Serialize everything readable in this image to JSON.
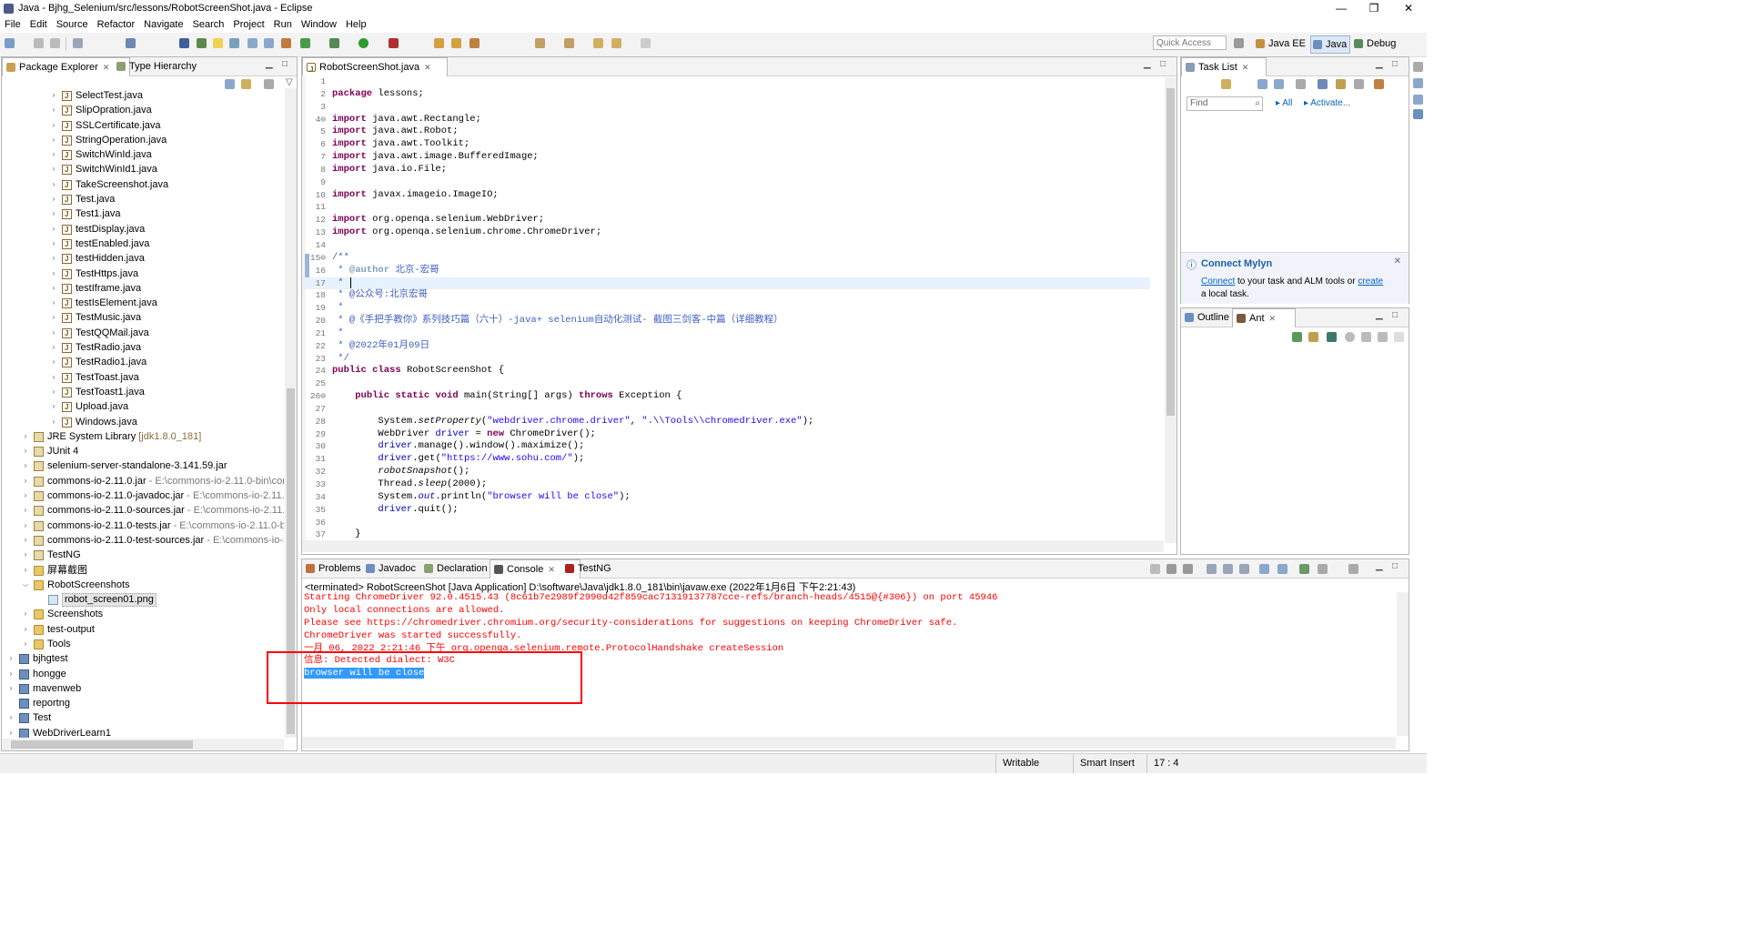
{
  "window": {
    "title": "Java - Bjhg_Selenium/src/lessons/RobotScreenShot.java - Eclipse"
  },
  "menu": [
    "File",
    "Edit",
    "Source",
    "Refactor",
    "Navigate",
    "Search",
    "Project",
    "Run",
    "Window",
    "Help"
  ],
  "toolbar": {
    "quick_access_placeholder": "Quick Access",
    "perspectives": [
      "Java EE",
      "Java",
      "Debug"
    ]
  },
  "package_explorer": {
    "tabs": [
      "Package Explorer",
      "Type Hierarchy"
    ],
    "items": [
      {
        "label": "SelectTest.java",
        "kind": "java",
        "level": 3,
        "twisty": ">"
      },
      {
        "label": "SlipOpration.java",
        "kind": "java",
        "level": 3,
        "twisty": ">"
      },
      {
        "label": "SSLCertificate.java",
        "kind": "java",
        "level": 3,
        "twisty": ">"
      },
      {
        "label": "StringOperation.java",
        "kind": "java",
        "level": 3,
        "twisty": ">"
      },
      {
        "label": "SwitchWinId.java",
        "kind": "java",
        "level": 3,
        "twisty": ">"
      },
      {
        "label": "SwitchWinId1.java",
        "kind": "java",
        "level": 3,
        "twisty": ">"
      },
      {
        "label": "TakeScreenshot.java",
        "kind": "java",
        "level": 3,
        "twisty": ">"
      },
      {
        "label": "Test.java",
        "kind": "java",
        "level": 3,
        "twisty": ">"
      },
      {
        "label": "Test1.java",
        "kind": "java",
        "level": 3,
        "twisty": ">"
      },
      {
        "label": "testDisplay.java",
        "kind": "java",
        "level": 3,
        "twisty": ">"
      },
      {
        "label": "testEnabled.java",
        "kind": "java",
        "level": 3,
        "twisty": ">"
      },
      {
        "label": "testHidden.java",
        "kind": "java",
        "level": 3,
        "twisty": ">"
      },
      {
        "label": "TestHttps.java",
        "kind": "java",
        "level": 3,
        "twisty": ">"
      },
      {
        "label": "testIframe.java",
        "kind": "java",
        "level": 3,
        "twisty": ">"
      },
      {
        "label": "testIsElement.java",
        "kind": "java",
        "level": 3,
        "twisty": ">"
      },
      {
        "label": "TestMusic.java",
        "kind": "java",
        "level": 3,
        "twisty": ">"
      },
      {
        "label": "TestQQMail.java",
        "kind": "java",
        "level": 3,
        "twisty": ">"
      },
      {
        "label": "TestRadio.java",
        "kind": "java",
        "level": 3,
        "twisty": ">"
      },
      {
        "label": "TestRadio1.java",
        "kind": "java",
        "level": 3,
        "twisty": ">"
      },
      {
        "label": "TestToast.java",
        "kind": "java",
        "level": 3,
        "twisty": ">"
      },
      {
        "label": "TestToast1.java",
        "kind": "java",
        "level": 3,
        "twisty": ">"
      },
      {
        "label": "Upload.java",
        "kind": "java",
        "level": 3,
        "twisty": ">"
      },
      {
        "label": "Windows.java",
        "kind": "java",
        "level": 3,
        "twisty": ">"
      },
      {
        "label": "JRE System Library",
        "extra": "[jdk1.8.0_181]",
        "kind": "jar",
        "level": 1,
        "twisty": ">"
      },
      {
        "label": "JUnit 4",
        "kind": "jar",
        "level": 1,
        "twisty": ">"
      },
      {
        "label": "selenium-server-standalone-3.141.59.jar",
        "kind": "jar",
        "level": 1,
        "twisty": ">"
      },
      {
        "label": "commons-io-2.11.0.jar",
        "extra": " - E:\\commons-io-2.11.0-bin\\cor",
        "kind": "jar",
        "level": 1,
        "twisty": ">"
      },
      {
        "label": "commons-io-2.11.0-javadoc.jar",
        "extra": " - E:\\commons-io-2.11.0",
        "kind": "jar",
        "level": 1,
        "twisty": ">"
      },
      {
        "label": "commons-io-2.11.0-sources.jar",
        "extra": " - E:\\commons-io-2.11.0",
        "kind": "jar",
        "level": 1,
        "twisty": ">"
      },
      {
        "label": "commons-io-2.11.0-tests.jar",
        "extra": " - E:\\commons-io-2.11.0-bi",
        "kind": "jar",
        "level": 1,
        "twisty": ">"
      },
      {
        "label": "commons-io-2.11.0-test-sources.jar",
        "extra": " - E:\\commons-io-2",
        "kind": "jar",
        "level": 1,
        "twisty": ">"
      },
      {
        "label": "TestNG",
        "kind": "jar",
        "level": 1,
        "twisty": ">"
      },
      {
        "label": "屏幕截图",
        "kind": "folder",
        "level": 1,
        "twisty": ">"
      },
      {
        "label": "RobotScreenshots",
        "kind": "folder",
        "level": 1,
        "twisty": "v"
      },
      {
        "label": "robot_screen01.png",
        "kind": "png",
        "level": 2,
        "twisty": "",
        "selected": true
      },
      {
        "label": "Screenshots",
        "kind": "folder",
        "level": 1,
        "twisty": ">"
      },
      {
        "label": "test-output",
        "kind": "folder",
        "level": 1,
        "twisty": ">"
      },
      {
        "label": "Tools",
        "kind": "folder",
        "level": 1,
        "twisty": ">"
      },
      {
        "label": "bjhgtest",
        "kind": "project",
        "level": 0,
        "twisty": ">"
      },
      {
        "label": "hongge",
        "kind": "project",
        "level": 0,
        "twisty": ">"
      },
      {
        "label": "mavenweb",
        "kind": "project",
        "level": 0,
        "twisty": ">"
      },
      {
        "label": "reportng",
        "kind": "project",
        "level": 0,
        "twisty": ""
      },
      {
        "label": "Test",
        "kind": "project",
        "level": 0,
        "twisty": ">"
      },
      {
        "label": "WebDriverLearn1",
        "kind": "project",
        "level": 0,
        "twisty": ">"
      }
    ]
  },
  "editor": {
    "tab": "RobotScreenShot.java",
    "lines": [
      {
        "n": "1",
        "html": ""
      },
      {
        "n": "2",
        "html": "<span class='kw'>package</span> lessons;"
      },
      {
        "n": "3",
        "html": ""
      },
      {
        "n": "4⊖",
        "html": "<span class='kw'>import</span> java.awt.Rectangle;"
      },
      {
        "n": "5",
        "html": "<span class='kw'>import</span> java.awt.Robot;"
      },
      {
        "n": "6",
        "html": "<span class='kw'>import</span> java.awt.Toolkit;"
      },
      {
        "n": "7",
        "html": "<span class='kw'>import</span> java.awt.image.BufferedImage;"
      },
      {
        "n": "8",
        "html": "<span class='kw'>import</span> java.io.File;"
      },
      {
        "n": "9",
        "html": ""
      },
      {
        "n": "10",
        "html": "<span class='kw'>import</span> javax.imageio.ImageIO;"
      },
      {
        "n": "11",
        "html": ""
      },
      {
        "n": "12",
        "html": "<span class='kw'>import</span> org.openqa.selenium.WebDriver;"
      },
      {
        "n": "13",
        "html": "<span class='kw'>import</span> org.openqa.selenium.chrome.ChromeDriver;"
      },
      {
        "n": "14",
        "html": ""
      },
      {
        "n": "15⊖",
        "html": "<span class='com'>/**</span>"
      },
      {
        "n": "16",
        "html": "<span class='com'> * <span class='tag'>@author</span> 北京-宏哥</span>"
      },
      {
        "n": "17",
        "html": "<span class='com'> * </span>",
        "cur": true
      },
      {
        "n": "18",
        "html": "<span class='com'> * @公众号:北京宏哥</span>"
      },
      {
        "n": "19",
        "html": "<span class='com'> *</span>"
      },
      {
        "n": "20",
        "html": "<span class='com'> * @《手把手教你》系列技巧篇（六十）-java+ selenium自动化测试- 截图三剑客-中篇（详细教程）</span>"
      },
      {
        "n": "21",
        "html": "<span class='com'> *</span>"
      },
      {
        "n": "22",
        "html": "<span class='com'> * @2022年01月09日</span>"
      },
      {
        "n": "23",
        "html": "<span class='com'> */</span>"
      },
      {
        "n": "24",
        "html": "<span class='kw'>public</span> <span class='kw'>class</span> RobotScreenShot {"
      },
      {
        "n": "25",
        "html": ""
      },
      {
        "n": "26⊖",
        "html": "    <span class='kw'>public</span> <span class='kw'>static</span> <span class='kw'>void</span> main(String[] args) <span class='kw'>throws</span> Exception {"
      },
      {
        "n": "27",
        "html": ""
      },
      {
        "n": "28",
        "html": "        System.<span class='ital'>setProperty</span>(<span class='str'>\"webdriver.chrome.driver\"</span>, <span class='str'>\".\\\\Tools\\\\chromedriver.exe\"</span>);"
      },
      {
        "n": "29",
        "html": "        WebDriver <span class='fld'>driver</span> = <span class='kw'>new</span> ChromeDriver();"
      },
      {
        "n": "30",
        "html": "        <span class='fld'>driver</span>.manage().window().maximize();"
      },
      {
        "n": "31",
        "html": "        <span class='fld'>driver</span>.get(<span class='str'>\"https://www.sohu.com/\"</span>);"
      },
      {
        "n": "32",
        "html": "        <span class='ital'>robotSnapshot</span>();"
      },
      {
        "n": "33",
        "html": "        Thread.<span class='ital'>sleep</span>(2000);"
      },
      {
        "n": "34",
        "html": "        System.<span class='fld ital'>out</span>.println(<span class='str'>\"browser will be close\"</span>);"
      },
      {
        "n": "35",
        "html": "        <span class='fld'>driver</span>.quit();"
      },
      {
        "n": "36",
        "html": ""
      },
      {
        "n": "37",
        "html": "    }"
      }
    ]
  },
  "task_list": {
    "tab": "Task List",
    "find_placeholder": "Find",
    "all_label": "All",
    "activate_label": "Activate..."
  },
  "mylyn": {
    "title": "Connect Mylyn",
    "connect": "Connect",
    "mid": " to your task and ALM tools or ",
    "create": "create",
    "tail": "a local task."
  },
  "outline": {
    "tabs": [
      "Outline",
      "Ant"
    ]
  },
  "bottom": {
    "tabs": [
      "Problems",
      "Javadoc",
      "Declaration",
      "Console",
      "TestNG"
    ],
    "header": "<terminated> RobotScreenShot [Java Application] D:\\software\\Java\\jdk1.8.0_181\\bin\\javaw.exe (2022年1月6日 下午2:21:43)",
    "lines": [
      "Starting ChromeDriver 92.0.4515.43 (8c61b7e2989f2990d42f859cac71319137787cce-refs/branch-heads/4515@{#306}) on port 45946",
      "Only local connections are allowed.",
      "Please see https://chromedriver.chromium.org/security-considerations for suggestions on keeping ChromeDriver safe.",
      "ChromeDriver was started successfully.",
      "一月 06, 2022 2:21:46 下午 org.openqa.selenium.remote.ProtocolHandshake createSession",
      "信息: Detected dialect: W3C",
      "browser will be close"
    ]
  },
  "status": {
    "writable": "Writable",
    "insert": "Smart Insert",
    "position": "17 : 4"
  },
  "colors": {
    "annotation_red": "#ff0000",
    "selection": "#3399ff",
    "console_text": "#ff0000"
  }
}
